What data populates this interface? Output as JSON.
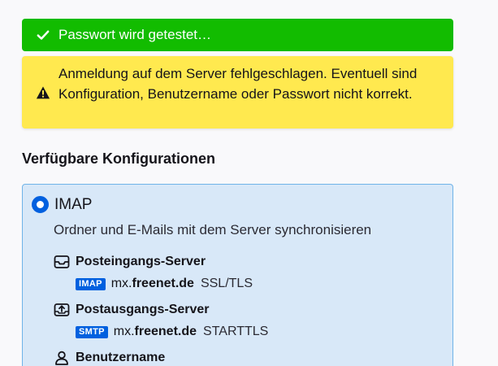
{
  "notifications": {
    "success": {
      "text": "Passwort wird getestet…",
      "color": "#12bc00",
      "icon": "check-icon"
    },
    "warning": {
      "text": "Anmeldung auf dem Server fehlgeschlagen. Eventuell sind Konfiguration, Benutzername oder Passwort nicht korrekt.",
      "color": "#ffe94f",
      "icon": "warning-icon"
    }
  },
  "section_title": "Verfügbare Konfigurationen",
  "config": {
    "protocol": "IMAP",
    "selected": true,
    "description": "Ordner und E-Mails mit dem Server synchronisieren",
    "incoming": {
      "title": "Posteingangs-Server",
      "icon": "inbox-icon",
      "badge": "IMAP",
      "host_prefix": "mx.",
      "host_domain": "freenet.de",
      "socket": "SSL/TLS"
    },
    "outgoing": {
      "title": "Postausgangs-Server",
      "icon": "outbox-icon",
      "badge": "SMTP",
      "host_prefix": "mx.",
      "host_domain": "freenet.de",
      "socket": "STARTTLS"
    },
    "username": {
      "title": "Benutzername",
      "icon": "user-icon"
    }
  },
  "colors": {
    "accent": "#0060df",
    "card_bg": "#d8e8f8",
    "card_border": "#6fb3e8"
  }
}
